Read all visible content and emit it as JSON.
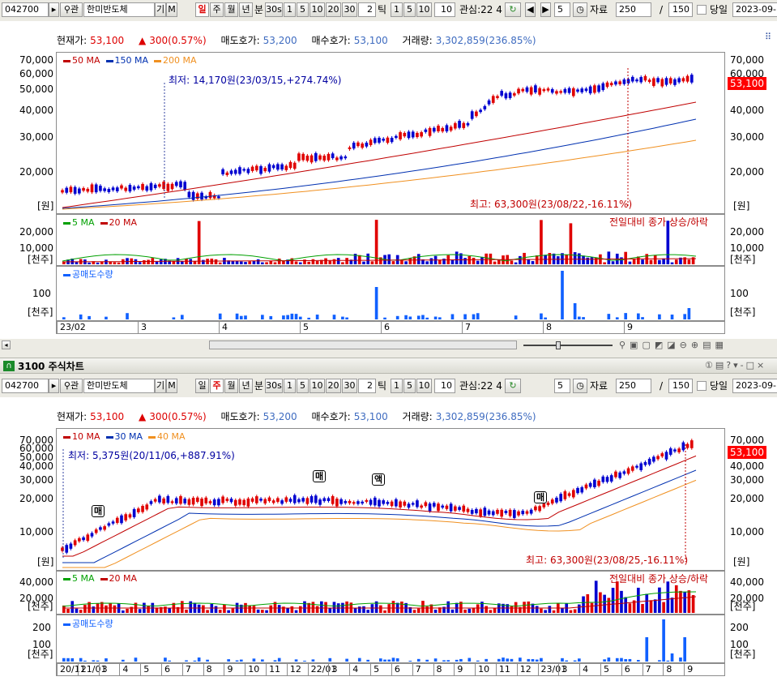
{
  "toolbar": {
    "code": "042700",
    "stock_name": "한미반도체",
    "period_day": "일",
    "period_week": "주",
    "period_month": "월",
    "period_year": "년",
    "minute": "분",
    "sec30": "30s",
    "btn1": "1",
    "btn5": "5",
    "btn10": "10",
    "btn20": "20",
    "btn30": "30",
    "tick_value": "2",
    "tick_label": "틱",
    "t1": "1",
    "t5": "5",
    "t10": "10",
    "t10b": "10",
    "interest_label": "관심:22 4",
    "count_value": "5",
    "data_label": "자료",
    "data_value": "250",
    "slash": "/",
    "total_value": "150",
    "today_label": "당일",
    "date_value": "2023-09-",
    "gi_label": "기",
    "m_label": "M",
    "search_label": "관"
  },
  "quote": {
    "current_label": "현재가:",
    "current_value": "53,100",
    "change_value": "300(0.57%)",
    "ask_label": "매도호가:",
    "ask_value": "53,200",
    "bid_label": "매수호가:",
    "bid_value": "53,100",
    "volume_label": "거래량:",
    "volume_value": "3,302,859(236.85%)"
  },
  "colors": {
    "up": "#e00000",
    "down": "#0000d0",
    "ma_short": "#c00000",
    "ma_mid": "#0030b0",
    "ma_long": "#f09020",
    "vol_ma5": "#00a000",
    "short_sell": "#1060ff"
  },
  "chart1": {
    "legend": [
      "50 MA",
      "150 MA",
      "200 MA"
    ],
    "y_ticks": [
      "70,000",
      "60,000",
      "50,000",
      "40,000",
      "30,000",
      "20,000"
    ],
    "unit": "[원]",
    "last_price": "53,100",
    "low_note": "최저: 14,170원(23/03/15,+274.74%)",
    "high_note": "최고: 63,300원(23/08/22,-16.11%)",
    "vol_legend": [
      "5 MA",
      "20 MA"
    ],
    "vol_note": "전일대비 종가 상승/하락",
    "vol_ticks": [
      "20,000",
      "10,000"
    ],
    "vol_unit": "[천주]",
    "short_legend": "공매도수량",
    "short_ticks": [
      "100"
    ],
    "short_unit": "[천주]",
    "dates": [
      "23/02",
      "3",
      "4",
      "5",
      "6",
      "7",
      "8",
      "9"
    ]
  },
  "window2": {
    "title": "3100 주식차트",
    "icon": "chart-window-icon"
  },
  "chart2": {
    "legend": [
      "10 MA",
      "30 MA",
      "40 MA"
    ],
    "y_ticks": [
      "70,000",
      "60,000",
      "50,000",
      "40,000",
      "30,000",
      "20,000",
      "10,000"
    ],
    "unit": "[원]",
    "last_price": "53,100",
    "low_note": "최저: 5,375원(20/11/06,+887.91%)",
    "high_note": "최고: 63,300원(23/08/25,-16.11%)",
    "signal_buy": "매",
    "signal_sell": "매",
    "signal_amt": "액",
    "vol_legend": [
      "5 MA",
      "20 MA"
    ],
    "vol_note": "전일대비 종가 상승/하락",
    "vol_ticks": [
      "40,000",
      "20,000"
    ],
    "vol_unit": "[천주]",
    "short_legend": "공매도수량",
    "short_ticks": [
      "200",
      "100"
    ],
    "short_unit": "[천주]",
    "dates": [
      "20/11",
      "21/01",
      "3",
      "4",
      "5",
      "6",
      "7",
      "8",
      "9",
      "10",
      "11",
      "12",
      "22/01",
      "3",
      "4",
      "5",
      "6",
      "7",
      "8",
      "9",
      "10",
      "11",
      "12",
      "23/01",
      "3",
      "4",
      "5",
      "6",
      "7",
      "8",
      "9"
    ]
  }
}
